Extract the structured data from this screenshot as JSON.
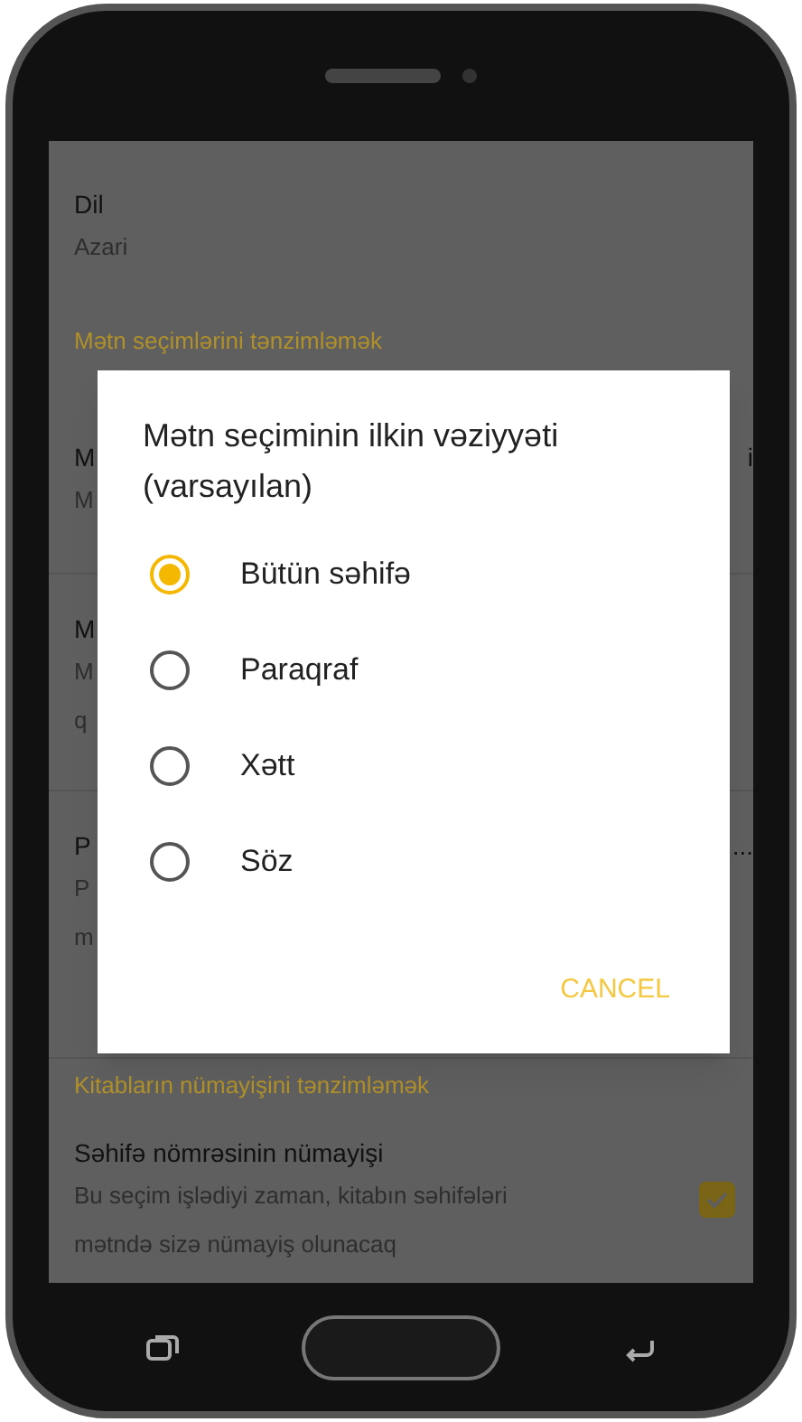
{
  "settings": {
    "items": [
      {
        "kind": "item",
        "title": "Dil",
        "subtitle": [
          "Azari"
        ]
      },
      {
        "kind": "header",
        "title": "Mətn seçimlərini tənzimləmək"
      },
      {
        "kind": "item",
        "title": "M",
        "subtitle": [
          "M"
        ],
        "trailing": "i"
      },
      {
        "kind": "item",
        "title": "M",
        "subtitle": [
          "M",
          "q"
        ]
      },
      {
        "kind": "item",
        "title": "P",
        "subtitle": [
          "P",
          "m"
        ],
        "trailing": "..."
      },
      {
        "kind": "header",
        "title": "Kitabların nümayişini tənzimləmək"
      },
      {
        "kind": "check",
        "title": "Səhifə nömrəsinin nümayişi",
        "subtitle": [
          "Bu seçim işlədiyi zaman, kitabın səhifələri",
          "mətndə sizə nümayiş olunacaq"
        ],
        "checked": true
      }
    ]
  },
  "dialog": {
    "title": "Mətn seçiminin ilkin vəziyyəti (varsayılan)",
    "options": [
      {
        "label": "Bütün səhifə",
        "selected": true
      },
      {
        "label": "Paraqraf",
        "selected": false
      },
      {
        "label": "Xətt",
        "selected": false
      },
      {
        "label": "Söz",
        "selected": false
      }
    ],
    "button": "CANCEL"
  }
}
